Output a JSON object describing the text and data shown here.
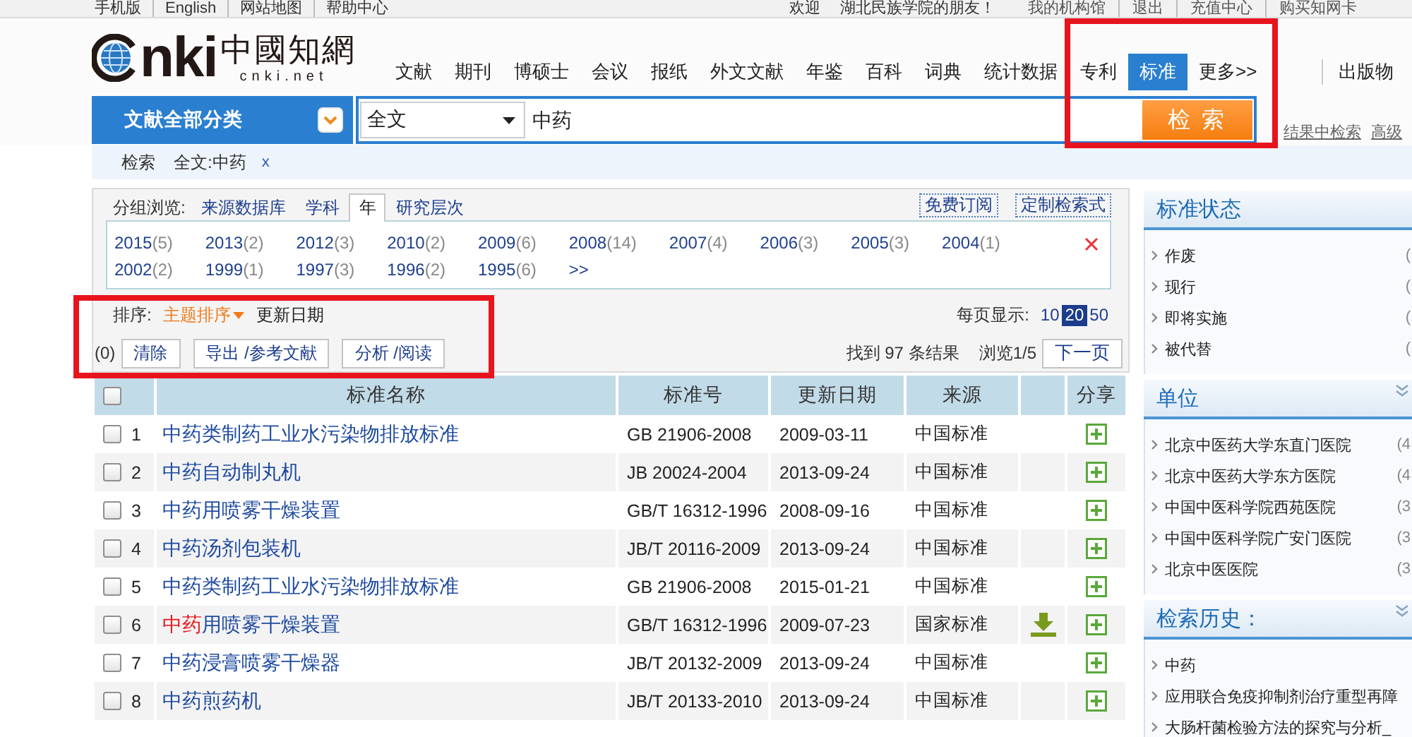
{
  "top_bar": {
    "left_links": [
      "手机版",
      "English",
      "网站地图",
      "帮助中心"
    ],
    "welcome": [
      "欢迎",
      "湖北民族学院的朋友！"
    ],
    "links": [
      "我的机构馆",
      "退出",
      "充值中心",
      "购买知网卡"
    ]
  },
  "logo": {
    "mark": "nki",
    "name": "中國知網",
    "domain": "cnki.net"
  },
  "nav": {
    "items": [
      {
        "label": "文献",
        "selected": false
      },
      {
        "label": "期刊",
        "selected": false
      },
      {
        "label": "博硕士",
        "selected": false
      },
      {
        "label": "会议",
        "selected": false
      },
      {
        "label": "报纸",
        "selected": false
      },
      {
        "label": "外文文献",
        "selected": false
      },
      {
        "label": "年鉴",
        "selected": false
      },
      {
        "label": "百科",
        "selected": false
      },
      {
        "label": "词典",
        "selected": false
      },
      {
        "label": "统计数据",
        "selected": false
      },
      {
        "label": "专利",
        "selected": false
      },
      {
        "label": "标准",
        "selected": true
      },
      {
        "label": "更多>>",
        "selected": false
      }
    ],
    "side_link": "出版物"
  },
  "search": {
    "category": "文献全部分类",
    "field": "全文",
    "value": "中药",
    "button": "检 索",
    "links": [
      "结果中检索",
      "高级"
    ]
  },
  "breadcrumb": {
    "label": "检索",
    "filter": "全文:中药",
    "remove": "x"
  },
  "grouping": {
    "label": "分组浏览:",
    "tabs": [
      {
        "label": "来源数据库",
        "selected": false
      },
      {
        "label": "学科",
        "selected": false
      },
      {
        "label": "年",
        "selected": true
      },
      {
        "label": "研究层次",
        "selected": false
      }
    ],
    "actions": [
      "免费订阅",
      "定制检索式"
    ],
    "years": [
      {
        "year": "2015",
        "count": "(5)"
      },
      {
        "year": "2013",
        "count": "(2)"
      },
      {
        "year": "2012",
        "count": "(3)"
      },
      {
        "year": "2010",
        "count": "(2)"
      },
      {
        "year": "2009",
        "count": "(6)"
      },
      {
        "year": "2008",
        "count": "(14)"
      },
      {
        "year": "2007",
        "count": "(4)"
      },
      {
        "year": "2006",
        "count": "(3)"
      },
      {
        "year": "2005",
        "count": "(3)"
      },
      {
        "year": "2004",
        "count": "(1)"
      },
      {
        "year": "2002",
        "count": "(2)"
      },
      {
        "year": "1999",
        "count": "(1)"
      },
      {
        "year": "1997",
        "count": "(3)"
      },
      {
        "year": "1996",
        "count": "(2)"
      },
      {
        "year": "1995",
        "count": "(6)"
      }
    ],
    "more": ">>"
  },
  "sort": {
    "label": "排序:",
    "options": [
      {
        "label": "主题排序",
        "selected": true
      },
      {
        "label": "更新日期",
        "selected": false
      }
    ],
    "page_size_label": "每页显示:",
    "page_sizes": [
      {
        "label": "10",
        "selected": false
      },
      {
        "label": "20",
        "selected": true
      },
      {
        "label": "50",
        "selected": false
      }
    ]
  },
  "actions": {
    "selected_count": "(0)",
    "buttons": [
      "清除",
      "导出 /参考文献",
      "分析 /阅读"
    ],
    "result_count": "找到 97 条结果",
    "page_info": "浏览1/5",
    "next": "下一页"
  },
  "table": {
    "header_checked": false,
    "columns": {
      "title": "标准名称",
      "number": "标准号",
      "date": "更新日期",
      "source": "来源",
      "share": "分享"
    },
    "rows": [
      {
        "index": "1",
        "checked": false,
        "title": [
          {
            "text": "中药类制药工业水污染物排放标准",
            "hit": false
          }
        ],
        "number": "GB 21906-2008",
        "date": "2009-03-11",
        "source": "中国标准",
        "download": false
      },
      {
        "index": "2",
        "checked": false,
        "title": [
          {
            "text": "中药自动制丸机",
            "hit": false
          }
        ],
        "number": "JB 20024-2004",
        "date": "2013-09-24",
        "source": "中国标准",
        "download": false
      },
      {
        "index": "3",
        "checked": false,
        "title": [
          {
            "text": "中药用喷雾干燥装置",
            "hit": false
          }
        ],
        "number": "GB/T 16312-1996",
        "date": "2008-09-16",
        "source": "中国标准",
        "download": false
      },
      {
        "index": "4",
        "checked": false,
        "title": [
          {
            "text": "中药汤剂包装机",
            "hit": false
          }
        ],
        "number": "JB/T 20116-2009",
        "date": "2013-09-24",
        "source": "中国标准",
        "download": false
      },
      {
        "index": "5",
        "checked": false,
        "title": [
          {
            "text": "中药类制药工业水污染物排放标准",
            "hit": false
          }
        ],
        "number": "GB 21906-2008",
        "date": "2015-01-21",
        "source": "中国标准",
        "download": false
      },
      {
        "index": "6",
        "checked": false,
        "title": [
          {
            "text": "中药",
            "hit": true
          },
          {
            "text": "用喷雾干燥装置",
            "hit": false
          }
        ],
        "number": "GB/T 16312-1996",
        "date": "2009-07-23",
        "source": "国家标准",
        "download": true
      },
      {
        "index": "7",
        "checked": false,
        "title": [
          {
            "text": "中药浸膏喷雾干燥器",
            "hit": false
          }
        ],
        "number": "JB/T 20132-2009",
        "date": "2013-09-24",
        "source": "中国标准",
        "download": false
      },
      {
        "index": "8",
        "checked": false,
        "title": [
          {
            "text": "中药煎药机",
            "hit": false
          }
        ],
        "number": "JB/T 20133-2010",
        "date": "2013-09-24",
        "source": "中国标准",
        "download": false
      }
    ]
  },
  "sidebar": {
    "sections": [
      {
        "title": "标准状态",
        "toggle": false,
        "items": [
          {
            "label": "作废",
            "count": "("
          },
          {
            "label": "现行",
            "count": "("
          },
          {
            "label": "即将实施",
            "count": "("
          },
          {
            "label": "被代替",
            "count": "("
          }
        ]
      },
      {
        "title": "单位",
        "toggle": true,
        "items": [
          {
            "label": "北京中医药大学东直门医院",
            "count": "(4"
          },
          {
            "label": "北京中医药大学东方医院",
            "count": "(4"
          },
          {
            "label": "中国中医科学院西苑医院",
            "count": "(3"
          },
          {
            "label": "中国中医科学院广安门医院",
            "count": "(3"
          },
          {
            "label": "北京中医医院",
            "count": "(3"
          }
        ]
      },
      {
        "title": "检索历史：",
        "toggle": true,
        "items": [
          {
            "label": "中药"
          },
          {
            "label": "应用联合免疫抑制剂治疗重型再障"
          },
          {
            "label": "大肠杆菌检验方法的探究与分析_"
          }
        ]
      }
    ]
  }
}
